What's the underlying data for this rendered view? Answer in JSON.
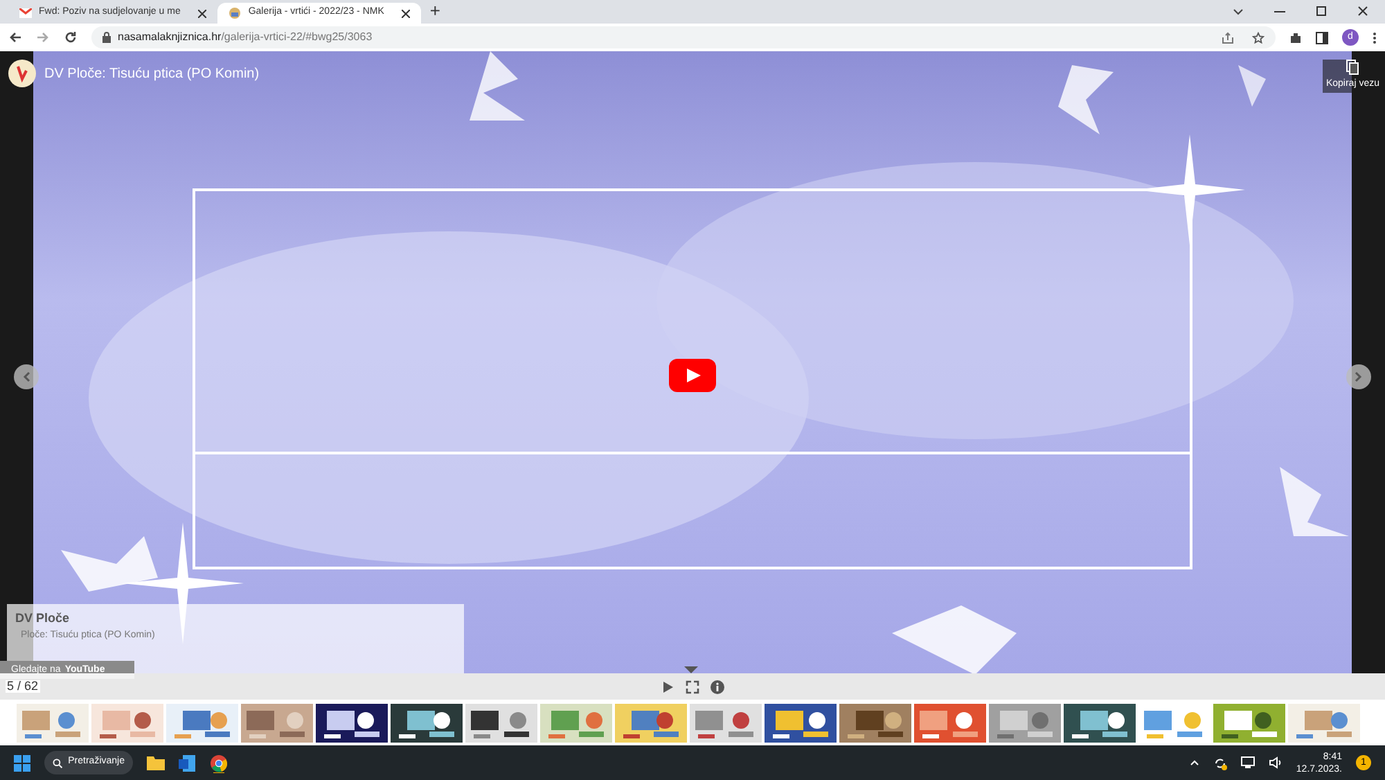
{
  "browser": {
    "tabs": [
      {
        "title": "Fwd: Poziv na sudjelovanje u me",
        "selected": false
      },
      {
        "title": "Galerija - vrtići - 2022/23 - NMK",
        "selected": true
      }
    ],
    "new_tab": "+",
    "url_host": "nasamalaknjiznica.hr",
    "url_path": "/galerija-vrtici-22/#bwg25/3063",
    "profile": "d"
  },
  "video": {
    "title": "DV Ploče: Tisuću ptica (PO Komin)",
    "copy_link": "Kopiraj vezu",
    "watch_on": "Gledajte na",
    "watch_brand": "YouTube"
  },
  "caption": {
    "title": "DV Ploče",
    "subtitle": "Ploče: Tisuću ptica (PO Komin)"
  },
  "counter": "5 / 62",
  "taskbar": {
    "search": "Pretraživanje",
    "time": "8:41",
    "date": "12.7.2023.",
    "notification": "1"
  }
}
